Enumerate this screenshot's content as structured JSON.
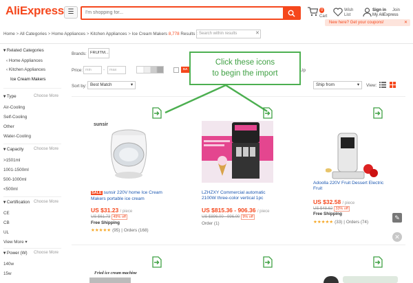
{
  "header": {
    "logo": "AliExpress",
    "search_placeholder": "I'm shopping for...",
    "cart_count": "0",
    "cart_label": "Cart",
    "wish_label": "Wish List",
    "signin_label": "Sign in",
    "my_label": "My AliExpress",
    "join_label": "Join",
    "coupon_text": "New here? Get your coupons!"
  },
  "breadcrumb": {
    "home": "Home",
    "all": "All Categories",
    "appliances": "Home Appliances",
    "kitchen": "Kitchen Appliances",
    "current": "Ice Cream Makers",
    "count": "8,778",
    "results": "Results :",
    "within_placeholder": "Search within results"
  },
  "sidebar": {
    "related": "Related Categories",
    "home_appliances": "Home Appliances",
    "kitchen_appliances": "Kitchen Appliances",
    "ice_cream": "Ice Cream Makers",
    "type_h": "Type",
    "choose_more": "Choose More",
    "type_items": [
      "Air-Cooling",
      "Self-Cooling",
      "Other",
      "Water-Cooling"
    ],
    "capacity_h": "Capacity",
    "capacity_items": [
      ">1501ml",
      "1001-1500ml",
      "500-1000ml",
      "<500ml"
    ],
    "cert_h": "Certification",
    "cert_items": [
      "CE",
      "CB",
      "UL"
    ],
    "view_more": "View More",
    "power_h": "Power (W)",
    "power_items": [
      "140w",
      "15w"
    ]
  },
  "filters": {
    "brands_label": "Brands:",
    "brand_value": "FRUITM...",
    "price_label": "Price:",
    "min": "min",
    "max": "max",
    "up": "Up",
    "sortby": "Sort by:",
    "sort_value": "Best Match",
    "ship_value": "Ship from",
    "view_label": "View:"
  },
  "callout": {
    "line1": "Click these icons",
    "line2": "to begin the import"
  },
  "products": [
    {
      "brand": "sunsir",
      "sale": "SALE",
      "title": "sunsir 220V home Ice Cream Makers portable ice cream",
      "price": "US $31.23",
      "piece": "/ piece",
      "old": "US $61.73",
      "off": "49% off",
      "shipping": "Free Shipping",
      "stars": "★★★★★",
      "rating": "(95)",
      "orders": "Orders (168)"
    },
    {
      "title": "LZHZXY Commercial automatic 2100W three-color vertical 1pc",
      "price": "US $815.36 - 906.36",
      "piece": "/ piece",
      "old": "US $896.00 - 996.00",
      "off": "9% off",
      "orders": "Order (1)"
    },
    {
      "title": "Adoolla 220V Fruit Dessert Electric Fruit",
      "price": "US $32.58",
      "piece": "/ piece",
      "old": "US $48.62",
      "off": "33% off",
      "shipping": "Free Shipping",
      "stars": "★★★★★",
      "rating": "(33)",
      "orders": "Orders (74)"
    }
  ],
  "row2_label": "Fried ice cream machine",
  "colors": {
    "accent": "#f5471c",
    "callout": "#4caf50",
    "link": "#1a56b0"
  }
}
